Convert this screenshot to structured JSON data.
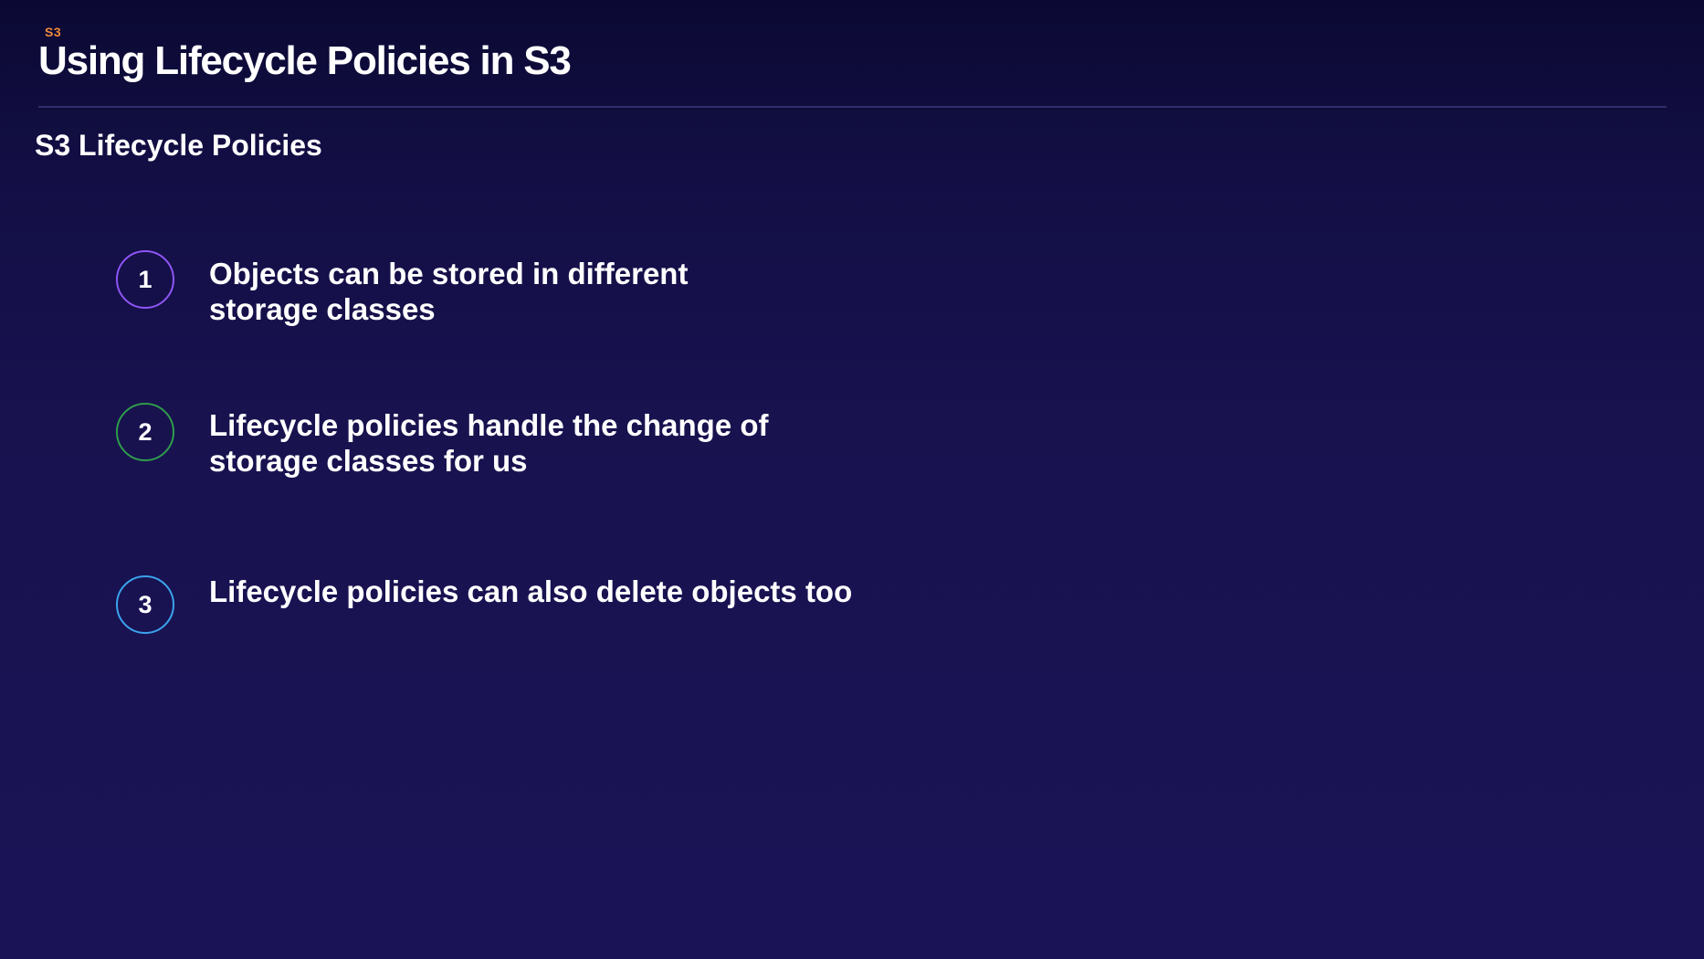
{
  "header": {
    "tag": "S3",
    "title": "Using Lifecycle Policies in S3"
  },
  "section": {
    "title": "S3 Lifecycle Policies"
  },
  "items": [
    {
      "number": "1",
      "line1": "Objects can be stored in different",
      "line2": "storage classes",
      "ring_color": "#8f55f5"
    },
    {
      "number": "2",
      "line1": "Lifecycle policies handle the change of",
      "line2": "storage classes for us",
      "ring_color": "#2f9c4b"
    },
    {
      "number": "3",
      "line1": "Lifecycle policies can also delete objects too",
      "ring_color": "#3ba4ec"
    }
  ],
  "colors": {
    "background": "#18124f",
    "tag": "#f08a3a",
    "divider": "#2e2f6b",
    "text": "#ffffff"
  }
}
